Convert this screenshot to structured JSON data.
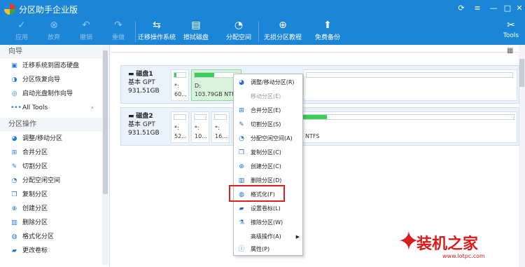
{
  "app": {
    "title": "分区助手企业版"
  },
  "toolbar": {
    "apply": "应用",
    "discard": "放弃",
    "undo": "撤销",
    "redo": "重做",
    "migrate_os": "迁移操作系统",
    "wipe_disk": "擦拭磁盘",
    "alloc_space": "分配空间",
    "lossless": "无损分区教程",
    "free_backup": "免费备份",
    "tools": "Tools"
  },
  "sidebar": {
    "wizard_title": "向导",
    "wizard_items": [
      "迁移系统到固态硬盘",
      "分区恢复向导",
      "启动光盘制作向导",
      "All Tools"
    ],
    "ops_title": "分区操作",
    "ops_items": [
      "调整/移动分区",
      "合并分区",
      "切割分区",
      "分配空闲空间",
      "复制分区",
      "创建分区",
      "删除分区",
      "格式化分区",
      "更改卷标"
    ]
  },
  "disks": [
    {
      "name": "磁盘1",
      "type": "基本 GPT",
      "size": "931.51GB",
      "parts": [
        {
          "label": "*:",
          "info": "60..."
        },
        {
          "label": "D:",
          "info": "103.79GB NTFS"
        }
      ]
    },
    {
      "name": "磁盘2",
      "type": "基本 GPT",
      "size": "931.51GB",
      "parts": [
        {
          "label": "*:",
          "info": "52..."
        },
        {
          "label": "*:",
          "info": "10..."
        },
        {
          "label": "*:",
          "info": "16..."
        },
        {
          "label": "",
          "info": "NTFS"
        }
      ]
    }
  ],
  "context_menu": [
    {
      "label": "调整/移动分区(R)",
      "icon": "resize-icon",
      "enabled": true
    },
    {
      "label": "移动分区(E)",
      "icon": "",
      "enabled": false
    },
    {
      "label": "合并分区(E)",
      "icon": "merge-icon",
      "enabled": true
    },
    {
      "label": "切割分区(S)",
      "icon": "split-icon",
      "enabled": true
    },
    {
      "label": "分配空闲空间(A)",
      "icon": "allocate-icon",
      "enabled": true
    },
    {
      "label": "复制分区(C)",
      "icon": "copy-icon",
      "enabled": true
    },
    {
      "label": "创建分区(C)",
      "icon": "create-icon",
      "enabled": true
    },
    {
      "label": "删除分区(D)",
      "icon": "delete-icon",
      "enabled": true
    },
    {
      "label": "格式化(F)",
      "icon": "format-icon",
      "enabled": true
    },
    {
      "label": "设置卷标(L)",
      "icon": "label-icon",
      "enabled": true
    },
    {
      "label": "擦除分区(W)",
      "icon": "wipe-icon",
      "enabled": true
    },
    {
      "label": "高级操作(A)",
      "icon": "",
      "enabled": true,
      "submenu": true
    },
    {
      "label": "属性(P)",
      "icon": "info-icon",
      "enabled": true
    }
  ],
  "watermark": {
    "text": "装机之家",
    "url": "www.lotpc.com"
  }
}
